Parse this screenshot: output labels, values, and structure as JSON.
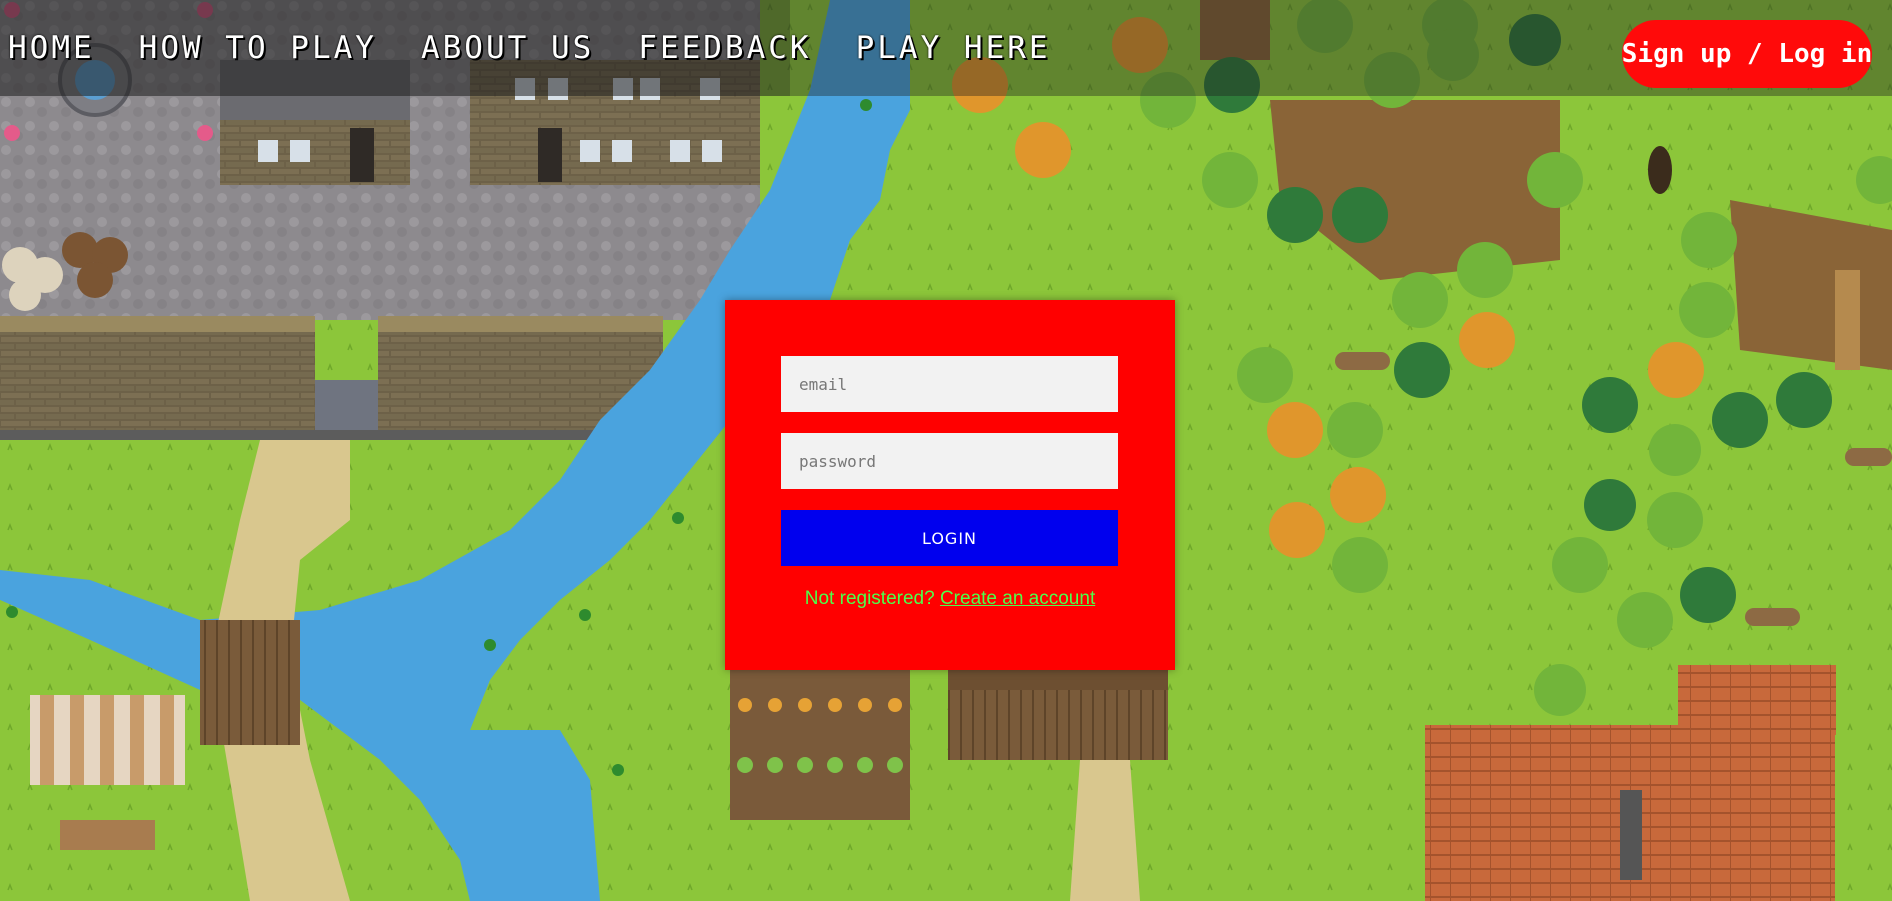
{
  "nav": {
    "items": [
      {
        "label": "HOME"
      },
      {
        "label": "HOW TO PLAY"
      },
      {
        "label": "ABOUT US"
      },
      {
        "label": "FEEDBACK"
      },
      {
        "label": "PLAY HERE"
      }
    ],
    "separator_icon": "crossed-swords-icon"
  },
  "auth": {
    "signup_login_label": "Sign up / Log in"
  },
  "login_form": {
    "email_placeholder": "email",
    "password_placeholder": "password",
    "login_label": "LOGIN",
    "not_registered_text": "Not registered?",
    "create_account_link": "Create an account"
  },
  "colors": {
    "form_bg": "#ff0000",
    "login_button": "#0000ee",
    "link_text": "#4cff4c",
    "signup_button": "#ff0a0a",
    "grass": "#8cc63a",
    "water": "#4aa3de"
  }
}
